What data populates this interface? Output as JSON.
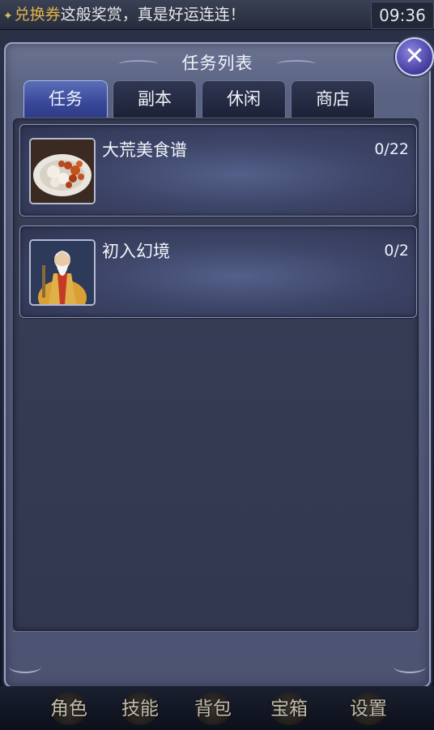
{
  "status_bar": {
    "marquee_prefix": "兑换券",
    "marquee_text": "这般奖赏，真是好运连连！",
    "time": "09:36"
  },
  "dialog": {
    "title": "任务列表",
    "close_icon": "close-icon"
  },
  "tabs": [
    {
      "label": "任务",
      "active": true
    },
    {
      "label": "副本",
      "active": false
    },
    {
      "label": "休闲",
      "active": false
    },
    {
      "label": "商店",
      "active": false
    }
  ],
  "quests": [
    {
      "name": "大荒美食谱",
      "progress": "0/22",
      "icon": "food-dish-icon"
    },
    {
      "name": "初入幻境",
      "progress": "0/2",
      "icon": "old-sage-icon"
    }
  ],
  "bottom_menu": [
    {
      "label": "角色"
    },
    {
      "label": "技能"
    },
    {
      "label": "背包"
    },
    {
      "label": "宝箱"
    },
    {
      "label": "设置"
    }
  ],
  "colors": {
    "accent_tab": "#3f4ea0",
    "dialog_bg": "#4c5372",
    "close_button": "#4c44a8"
  }
}
